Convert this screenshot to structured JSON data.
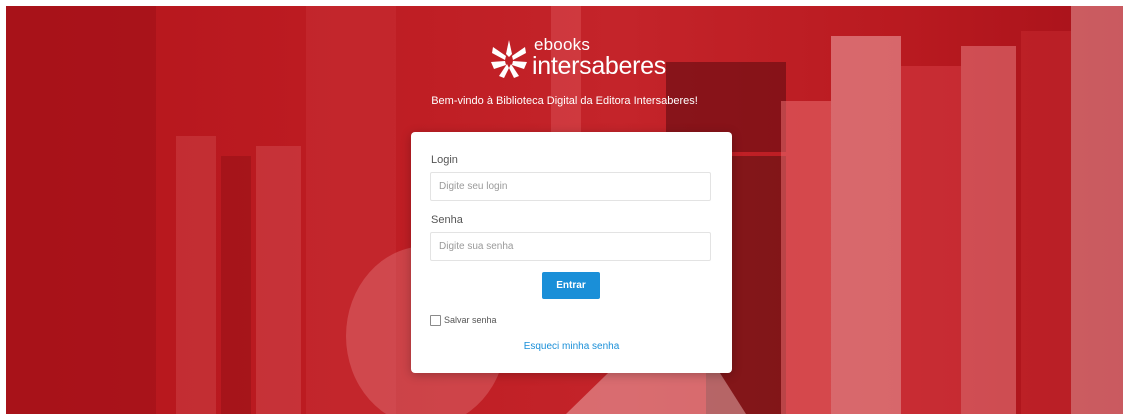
{
  "brand": {
    "name_top": "ebooks",
    "name_bottom": "intersaberes",
    "welcome": "Bem-vindo à Biblioteca Digital da Editora Intersaberes!"
  },
  "login_form": {
    "login_label": "Login",
    "login_placeholder": "Digite seu login",
    "login_value": "",
    "password_label": "Senha",
    "password_placeholder": "Digite sua senha",
    "password_value": "",
    "submit_label": "Entrar",
    "remember_label": "Salvar senha",
    "remember_checked": false,
    "forgot_label": "Esqueci minha senha"
  },
  "icons": {
    "logo": "starburst-book-logo-icon",
    "checkbox": "checkbox-unchecked-icon"
  },
  "colors": {
    "hero_red": "#c0262b",
    "primary_blue": "#1a8fd8",
    "card_bg": "#ffffff",
    "text_white": "#ffffff"
  }
}
